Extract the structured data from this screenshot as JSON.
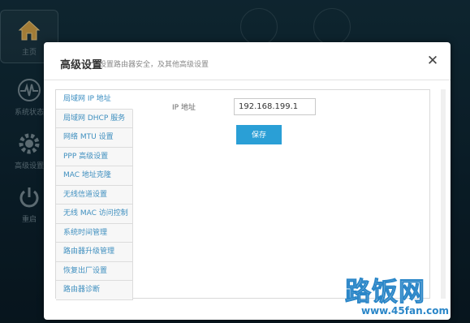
{
  "sidebar": {
    "items": [
      {
        "label": "主页",
        "icon": "home-icon"
      },
      {
        "label": "系统状态",
        "icon": "pulse-icon"
      },
      {
        "label": "高级设置",
        "icon": "gear-icon"
      },
      {
        "label": "重启",
        "icon": "power-icon"
      }
    ]
  },
  "modal": {
    "title": "高级设置",
    "subtitle": "设置路由器安全，及其他高级设置",
    "close_icon": "close-icon",
    "menu": [
      "局域网 IP 地址",
      "局域网 DHCP 服务",
      "网络 MTU 设置",
      "PPP 高级设置",
      "MAC 地址克隆",
      "无线信道设置",
      "无线 MAC 访问控制",
      "系统时间管理",
      "路由器升级管理",
      "恢复出厂设置",
      "路由器诊断"
    ],
    "active_menu_index": 0,
    "ip_label": "IP 地址",
    "ip_value": "192.168.199.1",
    "save_label": "保存"
  },
  "watermark": {
    "text": "路饭网",
    "url": "www.45fan.com"
  },
  "colors": {
    "accent": "#2a9fd6",
    "menu_text": "#3f8fbf",
    "background": "#0e2733"
  }
}
